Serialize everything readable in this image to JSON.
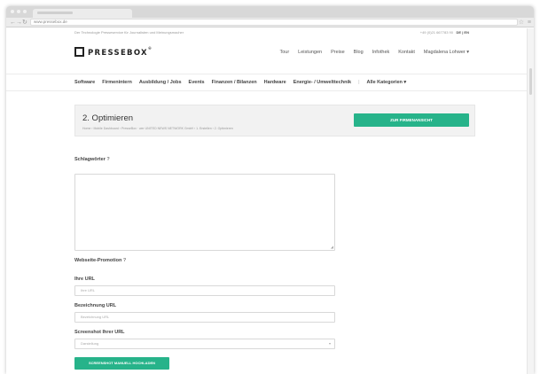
{
  "browser": {
    "url": "www.pressebox.de"
  },
  "topline": {
    "tagline": "Der Technologie Presseservice für Journalisten und Meinungsmacher",
    "phone": "+49 (0)21 667783 90",
    "lang": "DE | EN"
  },
  "logo": {
    "text": "PRESSEBOX",
    "mark": "®"
  },
  "mainnav": [
    "Tour",
    "Leistungen",
    "Preise",
    "Blog",
    "Infothek",
    "Kontakt",
    "Magdalena Lohwer ▾"
  ],
  "categories": [
    "Software",
    "Firmenintern",
    "Ausbildung / Jobs",
    "Events",
    "Finanzen / Bilanzen",
    "Hardware",
    "Energie- / Umwelttechnik"
  ],
  "categories_sep": "|",
  "categories_all": "Alle Kategorien ▾",
  "hero": {
    "title": "2. Optimieren",
    "breadcrumb": "Home › Mobile Dashboard › PresseBox · wer UNITED NEWS NETWORK GmbH › 1. Erstellen › 2. Optimieren",
    "button": "ZUR FIRMENANSICHT"
  },
  "form": {
    "keywords_label": "Schlagwörter",
    "help_mark": "?",
    "promo_label": "Webseite-Promotion",
    "url_label": "Ihre URL",
    "url_placeholder": "Ihre URL",
    "urlname_label": "Bezeichnung URL",
    "urlname_placeholder": "Bezeichnung URL",
    "screenshot_label": "Screenshot Ihrer URL",
    "screenshot_select": "Darstellung",
    "upload_button": "SCREENSHOT MANUELL HOCHLADEN"
  },
  "colors": {
    "accent": "#27b38a"
  }
}
